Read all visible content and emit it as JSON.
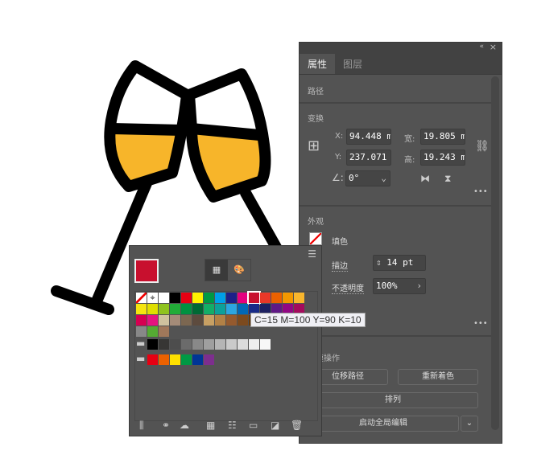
{
  "properties_panel": {
    "tabs": [
      "属性",
      "图层"
    ],
    "collapse_icon": "«",
    "close_icon": "×",
    "path_label": "路径",
    "transform": {
      "title": "变换",
      "x_label": "X:",
      "x_value": "94.448 m",
      "y_label": "Y:",
      "y_value": "237.071",
      "w_label": "宽:",
      "w_value": "19.805 m",
      "h_label": "高:",
      "h_value": "19.243 m",
      "angle_value": "0°"
    },
    "appearance": {
      "title": "外观",
      "fill_label": "填色",
      "stroke_label": "描边",
      "stroke_value": "14 pt",
      "opacity_label": "不透明度",
      "opacity_value": "100%"
    },
    "quick_actions": {
      "title": "快速操作",
      "offset_path": "位移路径",
      "recolor": "重新着色",
      "arrange": "排列",
      "global_edit": "启动全局编辑"
    },
    "more_icon": "•••"
  },
  "swatches_panel": {
    "current_fill": "#C8102E",
    "tooltip": "C=15 M=100 Y=90 K=10",
    "rows": [
      [
        "#ffffff",
        "#ffffff",
        "#ffffff",
        "#000000",
        "#e60012",
        "#fff100",
        "#009944",
        "#00a0e9",
        "#1d2088",
        "#e4007f",
        "#c8102e",
        "#e83828",
        "#eb6100",
        "#f39800",
        "#f8b62d"
      ],
      [
        "#f5e50f",
        "#dfdf00",
        "#8fc31f",
        "#22ac38",
        "#009140",
        "#006934",
        "#13ae67",
        "#0ca19a",
        "#2ca6e0",
        "#0068b7",
        "#172a88",
        "#1d2062",
        "#601986",
        "#920783",
        "#a40b5d"
      ],
      [
        "#d60051",
        "#e4157f",
        "#cfc29e",
        "#a48b78",
        "#7c6751",
        "#5d4b3e",
        "#c8a063",
        "#b28146",
        "#955a2e",
        "#7c4a1e",
        "#6a3906"
      ],
      [
        "#888888",
        "#55aa33",
        "#a0785a"
      ]
    ],
    "gray_group": [
      "#000000",
      "#373634",
      "#4d4d4d",
      "#6b6b6b",
      "#898989",
      "#9f9f9f",
      "#b5b5b5",
      "#cacaca",
      "#dcdcdc",
      "#efefef",
      "#f7f7f7"
    ],
    "color_group": [
      "#e60012",
      "#eb6100",
      "#ffe100",
      "#009944",
      "#003595",
      "#7d2e8e"
    ]
  },
  "artwork": {
    "stroke_color": "#000000",
    "liquid_color": "#F7B52A"
  }
}
